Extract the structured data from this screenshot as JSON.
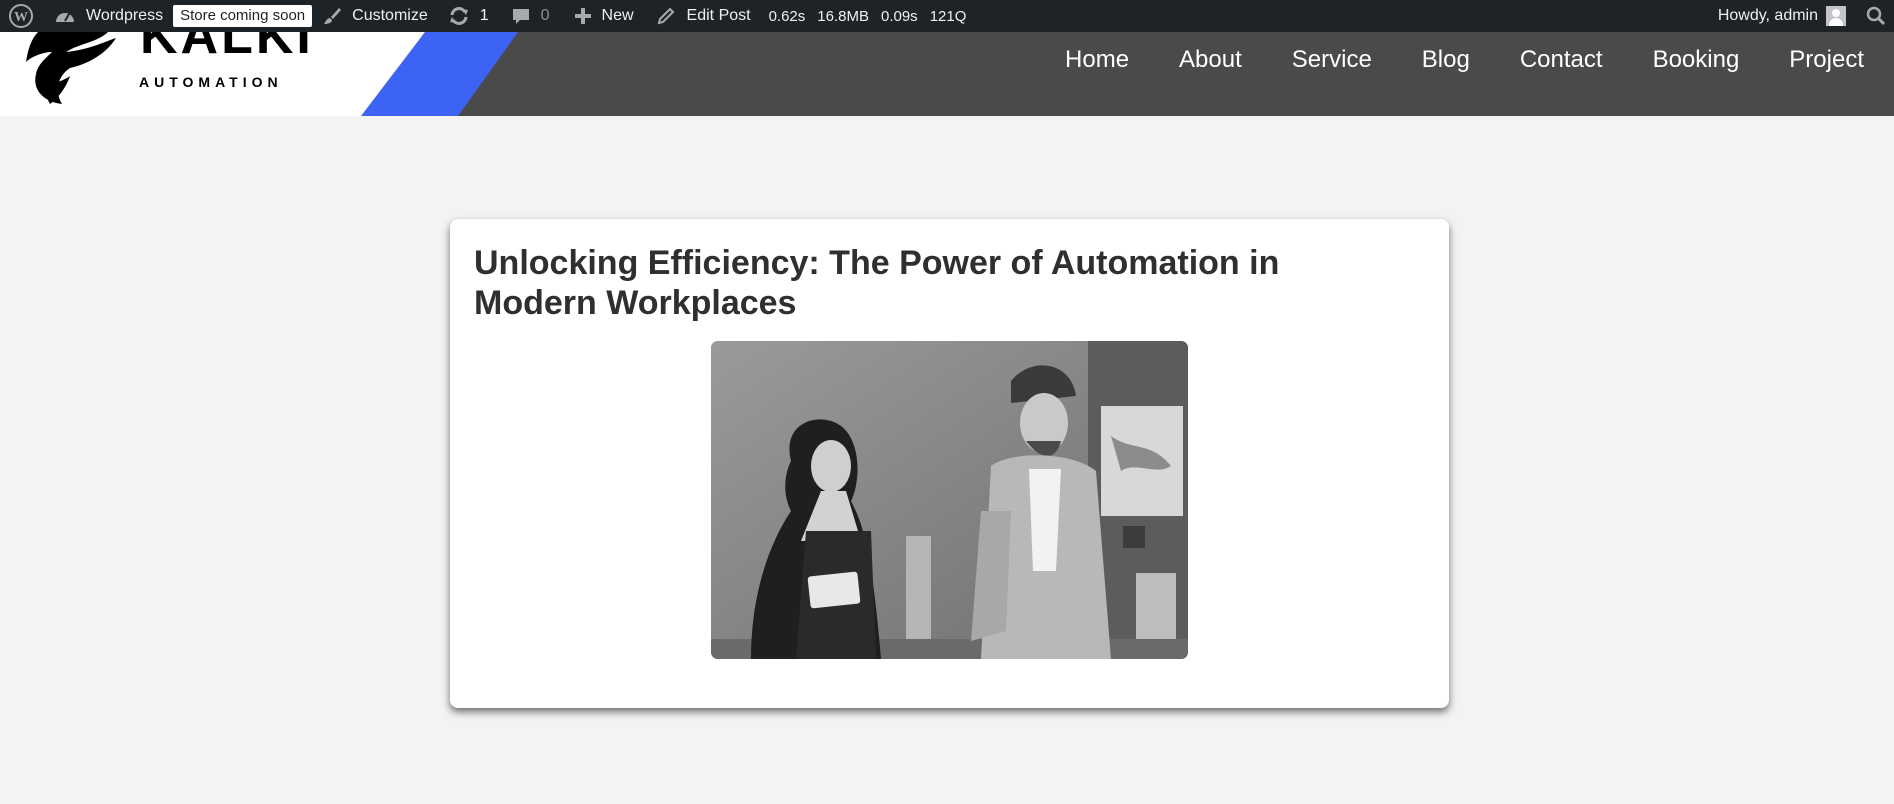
{
  "adminbar": {
    "site_name": "Wordpress",
    "store_badge": "Store coming soon",
    "customize": "Customize",
    "updates_count": "1",
    "comments_count": "0",
    "new_label": "New",
    "edit_post": "Edit Post",
    "stats": {
      "time": "0.62s",
      "memory": "16.8MB",
      "db_time": "0.09s",
      "queries": "121Q"
    },
    "howdy": "Howdy, admin",
    "icons": [
      "wordpress-logo-icon",
      "dashboard-icon",
      "brush-icon",
      "updates-icon",
      "comment-icon",
      "plus-icon",
      "pencil-icon",
      "avatar-icon",
      "search-icon"
    ]
  },
  "header": {
    "logo": {
      "brand_text": "KALKI",
      "brand_sub": "AUTOMATION"
    },
    "nav": [
      "Home",
      "About",
      "Service",
      "Blog",
      "Contact",
      "Booking",
      "Project"
    ],
    "colors": {
      "bar": "#4a4a4a",
      "accent": "#3d63f5"
    }
  },
  "post": {
    "title": "Unlocking Efficiency: The Power of Automation in Modern Workplaces"
  }
}
